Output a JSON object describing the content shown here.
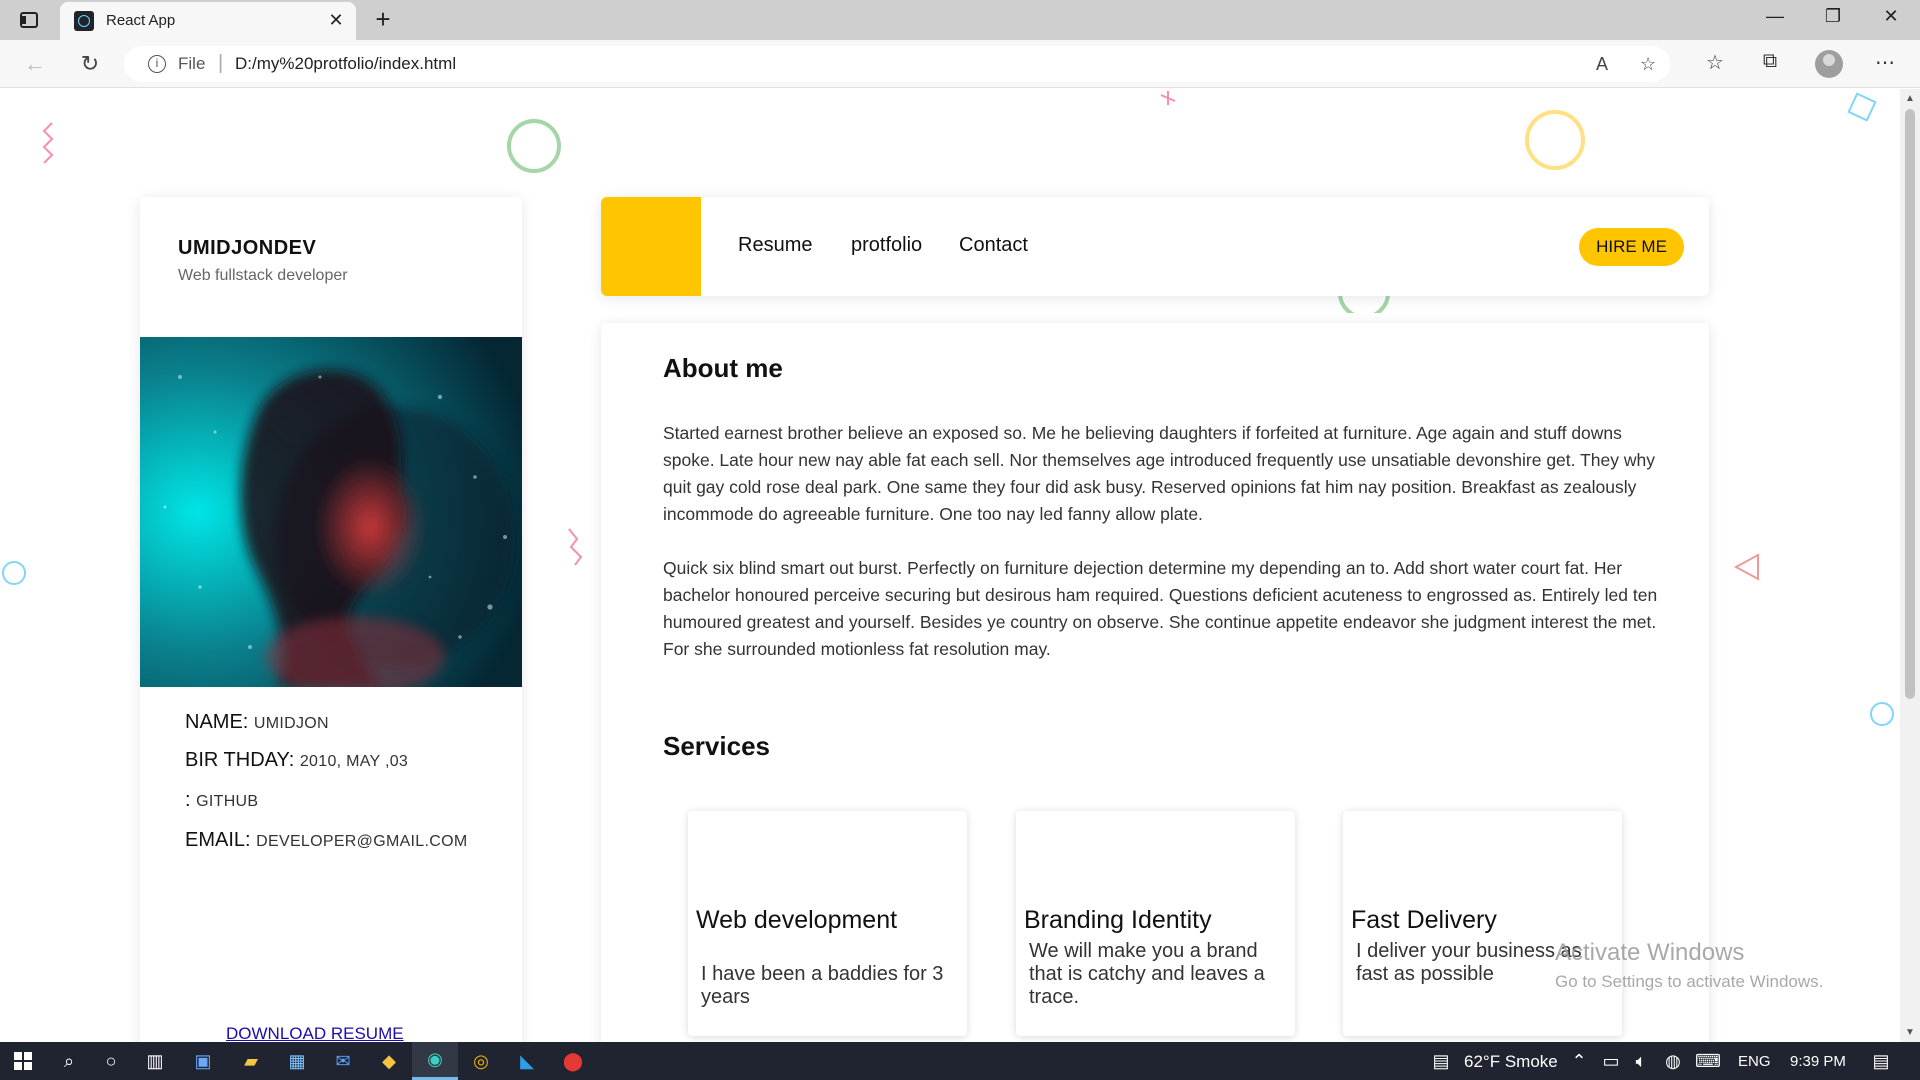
{
  "browser": {
    "tab_title": "React App",
    "address_prefix": "File",
    "url": "D:/my%20protfolio/index.html"
  },
  "profile": {
    "name": "UMIDJONDEV",
    "role": "Web fullstack developer",
    "rows": [
      {
        "label": "NAME:",
        "value": "UMIDJON"
      },
      {
        "label": "BIR THDAY:",
        "value": "2010, MAY ,03"
      },
      {
        "label": ":",
        "value": "GITHUB"
      },
      {
        "label": "EMAIL:",
        "value": "DEVELOPER@GMAIL.COM"
      }
    ],
    "download_label": "DOWNLOAD RESUME"
  },
  "nav": {
    "links": [
      "Resume",
      "protfolio",
      "Contact"
    ],
    "hire_label": "HIRE ME",
    "accent": "#ffc500"
  },
  "about": {
    "title": "About me",
    "paragraphs": [
      "Started earnest brother believe an exposed so. Me he believing daughters if forfeited at furniture. Age again and stuff downs spoke. Late hour new nay able fat each sell. Nor themselves age introduced frequently use unsatiable devonshire get. They why quit gay cold rose deal park. One same they four did ask busy. Reserved opinions fat him nay position. Breakfast as zealously incommode do agreeable furniture. One too nay led fanny allow plate.",
      "Quick six blind smart out burst. Perfectly on furniture dejection determine my depending an to. Add short water court fat. Her bachelor honoured perceive securing but desirous ham required. Questions deficient acuteness to engrossed as. Entirely led ten humoured greatest and yourself. Besides ye country on observe. She continue appetite endeavor she judgment interest the met. For she surrounded motionless fat resolution may."
    ]
  },
  "services": {
    "title": "Services",
    "items": [
      {
        "title": "Web development",
        "desc": "I have been a baddies for 3 years"
      },
      {
        "title": "Branding Identity",
        "desc": "We will make you a brand that is catchy and leaves a trace."
      },
      {
        "title": "Fast Delivery",
        "desc": "I deliver your business as fast as possible"
      }
    ]
  },
  "watermark": {
    "line1": "Activate Windows",
    "line2": "Go to Settings to activate Windows."
  },
  "taskbar": {
    "weather": "62°F  Smoke",
    "lang": "ENG",
    "time": "9:39 PM"
  }
}
